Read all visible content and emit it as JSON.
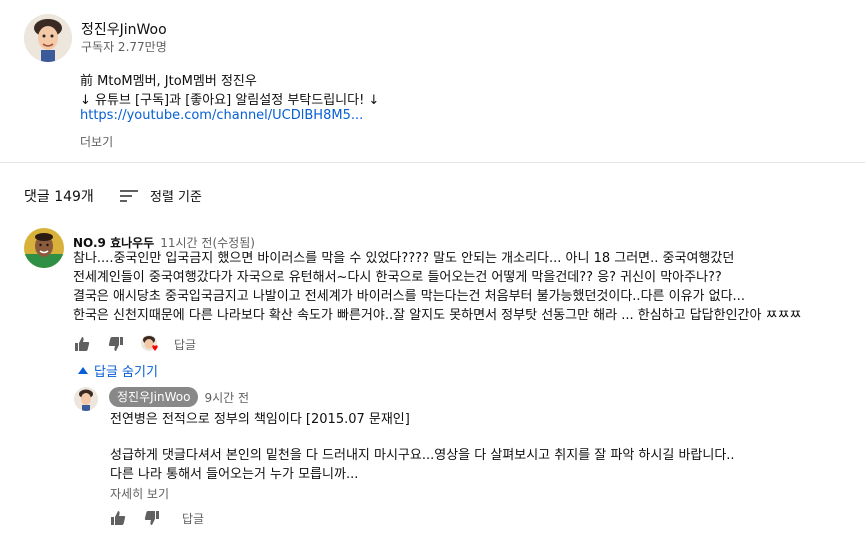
{
  "channel": {
    "name": "정진우JinWoo",
    "subscribers": "구독자 2.77만명",
    "desc_line1": "前 MtoM멤버, JtoM멤버 정진우",
    "desc_line2": "↓ 유튜브 [구독]과 [좋아요] 알림설정 부탁드립니다! ↓",
    "link": "https://youtube.com/channel/UCDlBH8M5...",
    "more_label": "더보기"
  },
  "comments_header": {
    "count": "댓글 149개",
    "sort_label": "정렬 기준"
  },
  "comment": {
    "author": "NO.9 효나우두",
    "time": "11시간 전(수정됨)",
    "lines": [
      "참나....중국인만 입국금지 했으면 바이러스를 막을 수 있었다???? 말도 안되는 개소리다... 아니 18 그러면.. 중국여행갔던",
      "전세계인들이 중국여행갔다가 자국으로 유턴해서~다시 한국으로 들어오는건 어떻게 막을건데?? 응? 귀신이 막아주나??",
      "결국은 애시당초 중국입국금지고 나발이고 전세계가 바이러스를 막는다는건 처음부터 불가능했던것이다..다른 이유가 없다...",
      "한국은 신천지때문에 다른 나라보다 확산 속도가 빠른거야..잘 알지도 못하면서 정부탓 선동그만 해라 ... 한심하고 답답한인간아 ㅉㅉㅉ"
    ],
    "reply_label": "답글",
    "hide_replies_label": "답글 숨기기"
  },
  "reply": {
    "author": "정진우JinWoo",
    "time": "9시간 전",
    "line1": "전연병은 전적으로 정부의 책임이다 [2015.07 문재인]",
    "line2": "성급하게 댓글다셔서 본인의 밑천을 다 드러내지 마시구요...영상을 다 살펴보시고 취지를 잘 파악 하시길 바랍니다..",
    "line3": "다른 나라 통해서 들어오는거 누가 모릅니까...",
    "read_more": "자세히 보기",
    "reply_label": "답글"
  },
  "colors": {
    "link": "#065fd4",
    "secondary_text": "#606060",
    "heart": "#ff0000",
    "owner_badge": "#888888"
  }
}
